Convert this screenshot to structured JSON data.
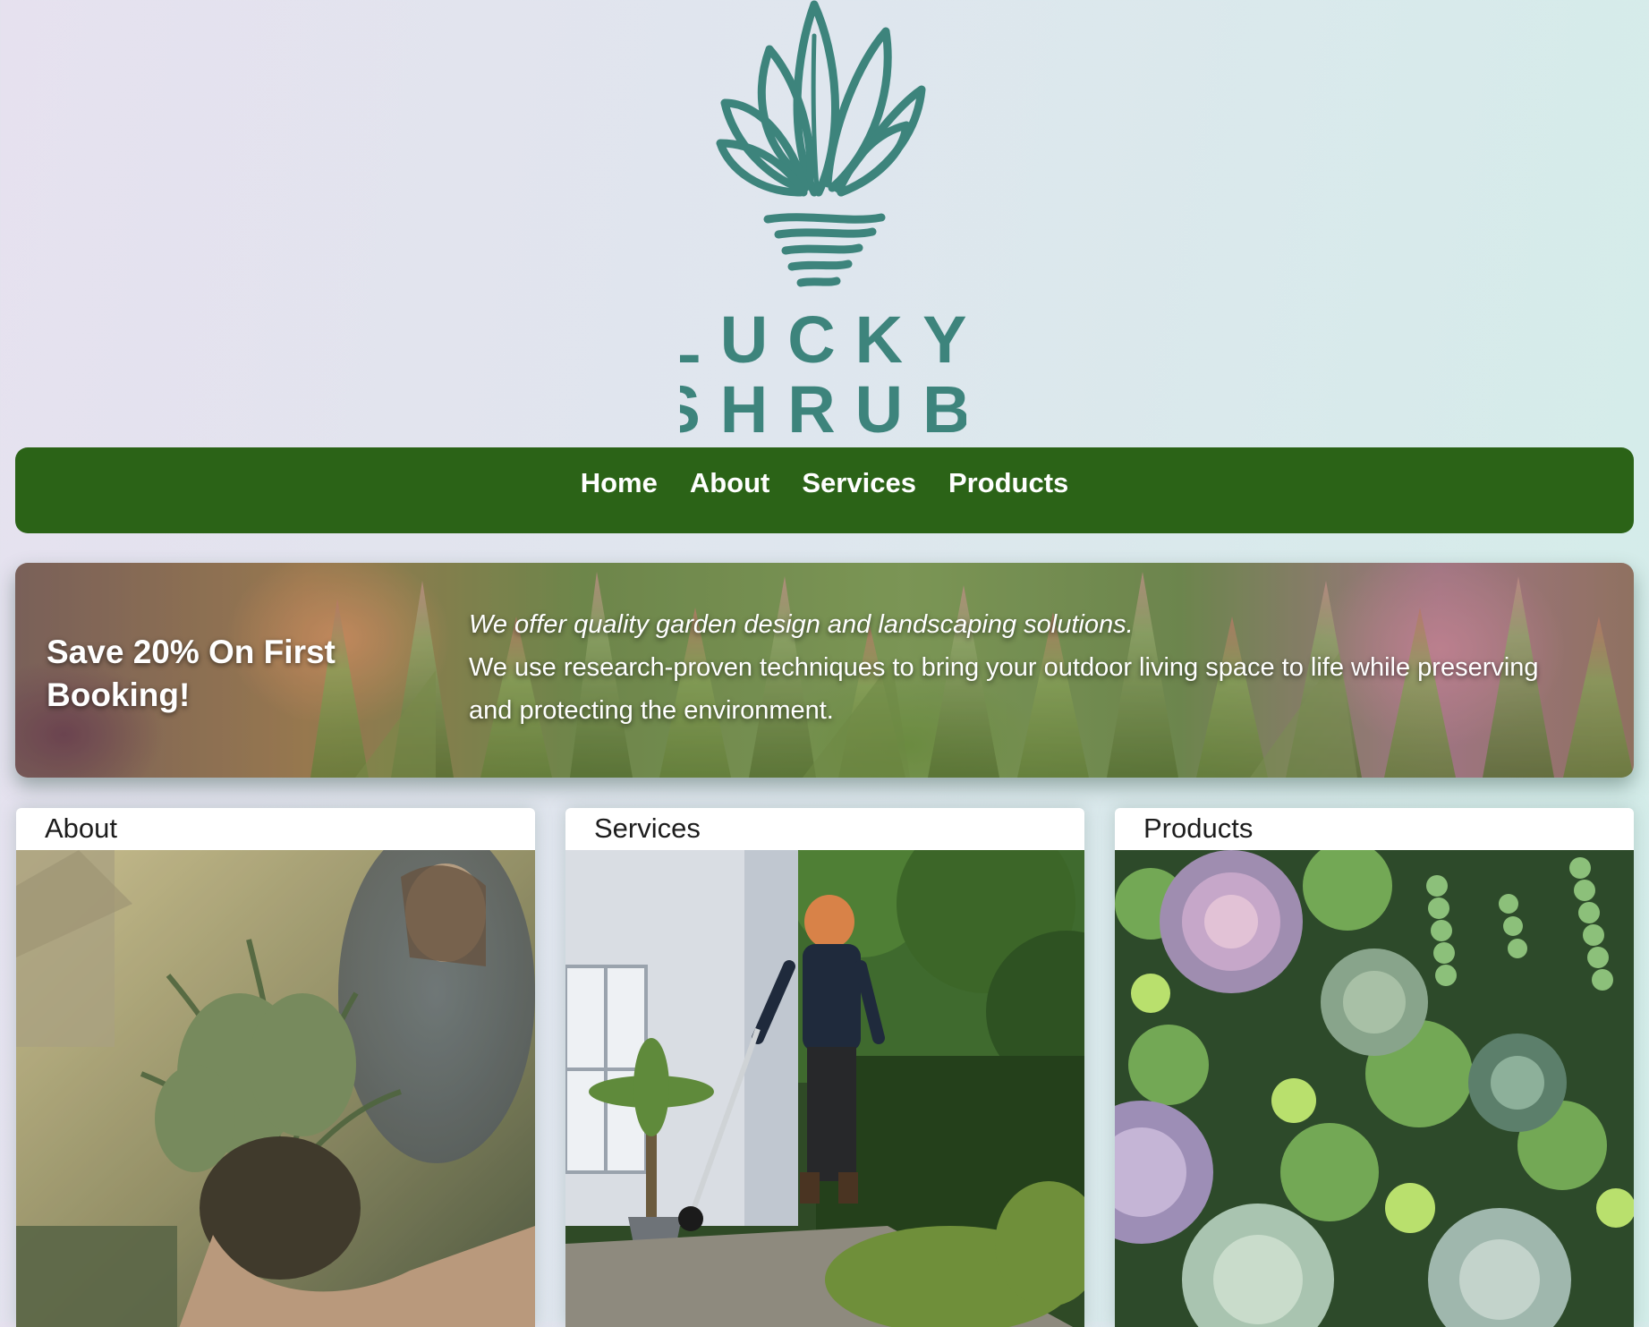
{
  "brand": {
    "logo_text_line1": "LUCKY",
    "logo_text_line2": "SHRUB",
    "logo_color": "#3d847c"
  },
  "nav": {
    "items": [
      {
        "label": "Home"
      },
      {
        "label": "About"
      },
      {
        "label": "Services"
      },
      {
        "label": "Products"
      }
    ],
    "background": "#2b6317"
  },
  "hero": {
    "offer": "Save 20% On First Booking!",
    "tagline": "We offer quality garden design and landscaping solutions.",
    "body": "We use research-proven techniques to bring your outdoor living space to life while preserving and protecting the environment."
  },
  "cards": [
    {
      "title": "About",
      "image": "gardener-holding-plant-photo"
    },
    {
      "title": "Services",
      "image": "worker-trimming-lawn-photo"
    },
    {
      "title": "Products",
      "image": "succulents-photo"
    }
  ]
}
